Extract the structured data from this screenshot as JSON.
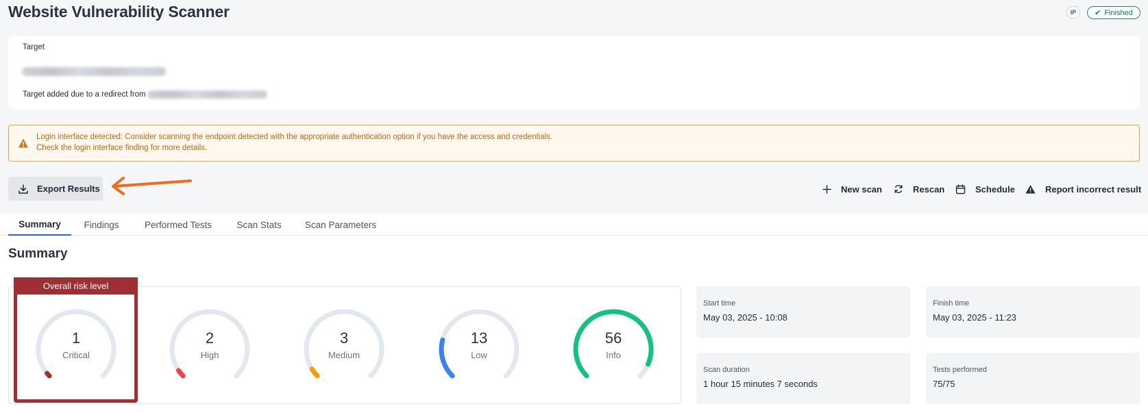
{
  "header": {
    "title": "Website Vulnerability Scanner",
    "ip_badge": "IP",
    "status": "Finished"
  },
  "target": {
    "label": "Target",
    "redirect_text": "Target added due to a redirect from"
  },
  "alert": {
    "icon": "warning-icon",
    "line1": "Login interface detected: Consider scanning the endpoint detected with the appropriate authentication option if you have the access and credentials.",
    "line2": "Check the login interface finding for more details."
  },
  "toolbar": {
    "export_label": "Export Results",
    "new_scan_label": "New scan",
    "rescan_label": "Rescan",
    "schedule_label": "Schedule",
    "report_label": "Report incorrect result"
  },
  "tabs": [
    {
      "label": "Summary",
      "active": true
    },
    {
      "label": "Findings",
      "active": false
    },
    {
      "label": "Performed Tests",
      "active": false
    },
    {
      "label": "Scan Stats",
      "active": false
    },
    {
      "label": "Scan Parameters",
      "active": false
    }
  ],
  "summary": {
    "title": "Summary",
    "risk_header": "Overall risk level",
    "gauges": [
      {
        "label": "Critical",
        "value": "1",
        "level": 0.02,
        "color": "#9e2f33"
      },
      {
        "label": "High",
        "value": "2",
        "level": 0.04,
        "color": "#ef4444"
      },
      {
        "label": "Medium",
        "value": "3",
        "level": 0.05,
        "color": "#f59e0b"
      },
      {
        "label": "Low",
        "value": "13",
        "level": 0.22,
        "color": "#3b82f6"
      },
      {
        "label": "Info",
        "value": "56",
        "level": 0.92,
        "color": "#10c47f"
      }
    ],
    "stats": [
      {
        "label": "Start time",
        "value": "May 03, 2025 - 10:08"
      },
      {
        "label": "Finish time",
        "value": "May 03, 2025 - 11:23"
      },
      {
        "label": "Scan duration",
        "value": "1 hour 15 minutes 7 seconds"
      },
      {
        "label": "Tests performed",
        "value": "75/75"
      }
    ]
  },
  "colors": {
    "accent": "#2563eb",
    "critical": "#9e2f33",
    "warning": "#c9660f",
    "success": "#16945f",
    "annotation_arrow": "#f26a1b"
  }
}
